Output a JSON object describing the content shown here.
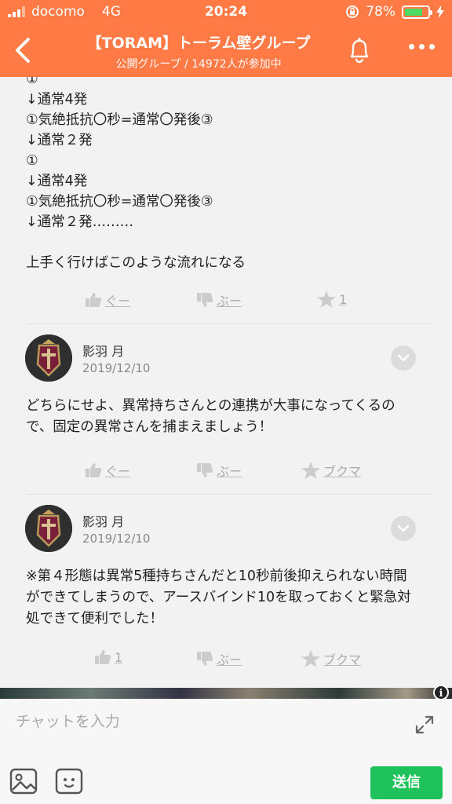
{
  "status": {
    "carrier": "docomo",
    "network": "4G",
    "time": "20:24",
    "battery": "78%",
    "battery_level": 0.78,
    "accent": "#ff7a45"
  },
  "header": {
    "title": "【TORAM】トーラム壁グループ",
    "subtitle": "公開グループ / 14972人が参加中"
  },
  "post1": {
    "lines": [
      "①",
      "↓通常4発",
      "①気絶抵抗〇秒=通常〇発後③",
      "↓通常２発",
      "①",
      "↓通常4発",
      "①気絶抵抗〇秒=通常〇発後③",
      "↓通常２発………",
      "",
      "上手く行けばこのような流れになる"
    ],
    "actions": {
      "good": "ぐー",
      "boo": "ぶー",
      "star": "1"
    }
  },
  "comments": [
    {
      "author": "影羽 月",
      "date": "2019/12/10",
      "text": "どちらにせよ、異常持ちさんとの連携が大事になってくるので、固定の異常さんを捕まえましょう！",
      "actions": {
        "good": "ぐー",
        "boo": "ぶー",
        "bookmark": "ブクマ"
      }
    },
    {
      "author": "影羽 月",
      "date": "2019/12/10",
      "text": "※第４形態は異常5種持ちさんだと10秒前後抑えられない時間ができてしまうので、アースバインド10を取っておくと緊急対処できて便利でした！",
      "actions": {
        "good": "1",
        "boo": "ぶー",
        "bookmark": "ブクマ"
      }
    }
  ],
  "chat": {
    "placeholder": "チャットを入力",
    "send_label": "送信",
    "send_color": "#1fc25a"
  },
  "icons": [
    "back-chevron-icon",
    "bell-icon",
    "more-dots-icon",
    "thumbs-up-icon",
    "thumbs-down-icon",
    "star-icon",
    "chevron-down-icon",
    "info-icon",
    "expand-icon",
    "image-icon",
    "sticker-icon"
  ]
}
